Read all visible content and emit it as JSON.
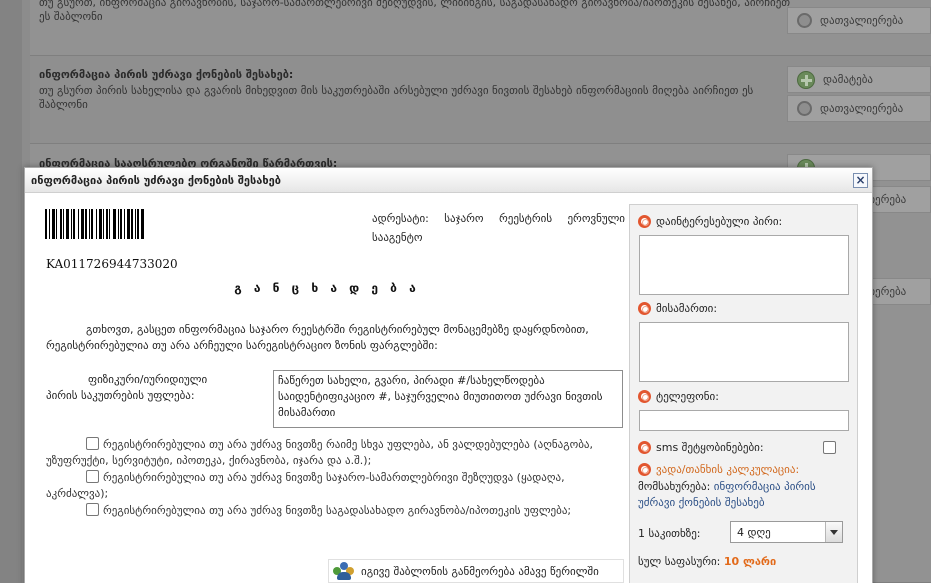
{
  "background": {
    "row1": {
      "desc": "თუ გსურთ, ინფორმაცია გირავნობის, საჯარო-სამართლებრივი შეზღუდვის, ლიზინგის, საგადასახადო გირავნობა/იპოთეკის შესახებ, აირჩიეთ ეს შაბლონი",
      "search_label": "დათვალიერება"
    },
    "row2": {
      "title": "ინფორმაცია პირის უძრავი ქონების შესახებ:",
      "desc": "თუ გსურთ პირის სახელისა და გვარის მიხედვით მის საკუთრებაში არსებული უძრავი ნივთის შესახებ ინფორმაციის მიღება აირჩიეთ ეს შაბლონი",
      "add_label": "დამატება",
      "search_label": "დათვალიერება"
    },
    "row3": {
      "title": "ინფორმაცია სააღსრულებო ორგანოში წარმართვის:",
      "search_label_a": "დათვალიერება",
      "search_label_b": "დათვალიერება"
    }
  },
  "modal": {
    "title": "ინფორმაცია პირის უძრავი ქონების შესახებ",
    "close": "×"
  },
  "document": {
    "code": "KA011726944733020",
    "address": "ადრესატი: საჯარო რეესტრის ეროვნული სააგენტო",
    "heading": "გ ა ნ ც ხ ა დ ე ბ ა",
    "request": "გთხოვთ, გასცეთ ინფორმაცია საჯარო რეესტრში რეგისტრირებულ მონაცემებზე დაყრდნობით, რეგისტრირებულია თუ არა არჩეული სარეგისტრაციო ზონის ფარგლებში:",
    "rights_label_1": "ფიზიკური/იურიდიული",
    "rights_label_2": "პირის საკუთრების უფლება:",
    "rights_textarea": "ჩაწერეთ სახელი, გვარი, პირადი #/სახელწოდება საიდენტიფიკაციო #, საჯურველია მიუთითოთ უძრავი ნივთის მისამართი",
    "checkbox_1": "რეგისტრირებულია თუ არა უძრავ ნივთზე რაიმე სხვა უფლება, ან ვალდებულება (აღნაგობა, უზუფრუქტი, სერვიტუტი, იპოთეკა, ქირავნობა, იჯარა და ა.შ.);",
    "checkbox_2": "რეგისტრირებულია თუ არა უძრავ ნივთზე საჯარო-სამართლებრივი შეზღუდვა (ყადაღა, აკრძალვა);",
    "checkbox_3": "რეგისტრირებულია თუ არა უძრავ ნივთზე საგადასახადო გირავნობა/იპოთეკის უფლება;",
    "same_template": "იგივე შაბლონის განმეორება ამავე წერილში"
  },
  "side": {
    "interested_label": "დაინტერესებული პირი:",
    "address_label": "მისამართი:",
    "phone_label": "ტელეფონი:",
    "sms_label": "sms შეტყობინებები:",
    "calc_link": "ვადა/თანხის კალკულაცია:",
    "dest_label": "მომსახურება:",
    "dest_link": "ინფორმაცია პირის უძრავი ქონების შესახებ",
    "question_label": "1 საკითხზე:",
    "select_value": "4 დღე",
    "total_label": "სულ საფასური:",
    "total_amount": "10 ლარი"
  },
  "colors": {
    "accent_orange": "#e26a1a",
    "link_blue": "#2b4f86",
    "ring_red": "#e2562f"
  }
}
